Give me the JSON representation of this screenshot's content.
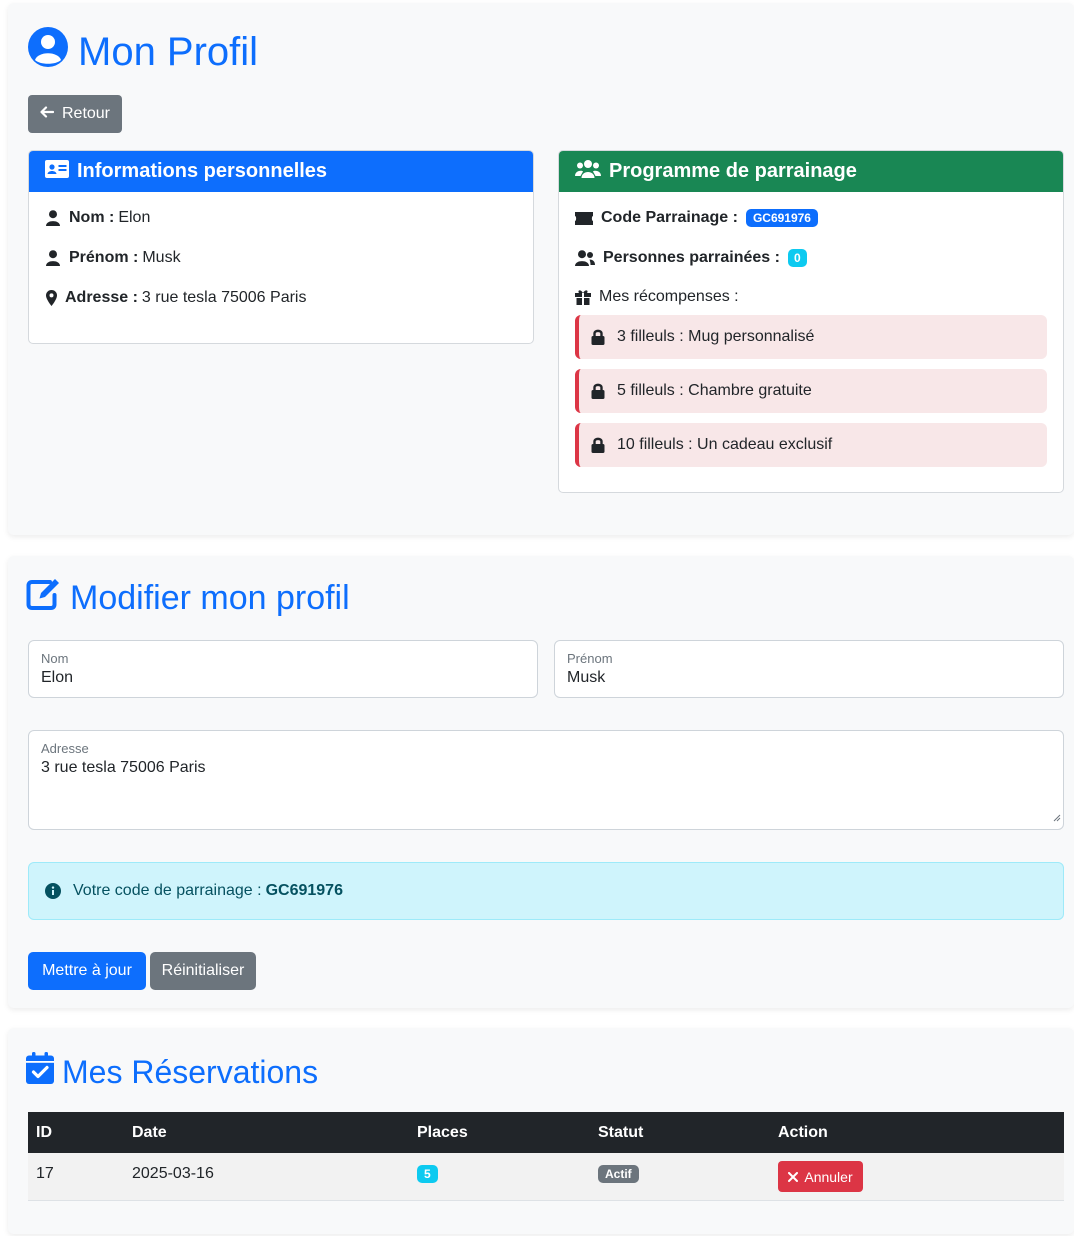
{
  "profile": {
    "title": "Mon Profil",
    "back_label": "Retour",
    "info_card": {
      "title": "Informations personnelles",
      "nom_label": "Nom :",
      "nom_value": "Elon",
      "prenom_label": "Prénom :",
      "prenom_value": "Musk",
      "adresse_label": "Adresse :",
      "adresse_value": "3 rue tesla 75006 Paris"
    },
    "referral_card": {
      "title": "Programme de parrainage",
      "code_label": "Code Parrainage :",
      "code_value": "GC691976",
      "count_label": "Personnes parrainées :",
      "count_value": "0",
      "rewards_label": "Mes récompenses :",
      "rewards": [
        {
          "text": "3 filleuls : Mug personnalisé"
        },
        {
          "text": "5 filleuls : Chambre gratuite"
        },
        {
          "text": "10 filleuls : Un cadeau exclusif"
        }
      ]
    }
  },
  "edit": {
    "title": "Modifier mon profil",
    "nom": {
      "label": "Nom",
      "value": "Elon"
    },
    "prenom": {
      "label": "Prénom",
      "value": "Musk"
    },
    "adresse": {
      "label": "Adresse",
      "value": "3 rue tesla 75006 Paris"
    },
    "alert_text": "Votre code de parrainage :",
    "alert_code": "GC691976",
    "update_label": "Mettre à jour",
    "reset_label": "Réinitialiser"
  },
  "reservations": {
    "title": "Mes Réservations",
    "headers": [
      "ID",
      "Date",
      "Places",
      "Statut",
      "Action"
    ],
    "rows": [
      {
        "id": "17",
        "date": "2025-03-16",
        "places": "5",
        "statut": "Actif",
        "action": "Annuler"
      }
    ]
  },
  "colors": {
    "primary": "#0d6efd",
    "success": "#198754",
    "danger": "#dc3545",
    "info": "#0dcaf0",
    "secondary": "#6c757d",
    "dark": "#212529"
  }
}
